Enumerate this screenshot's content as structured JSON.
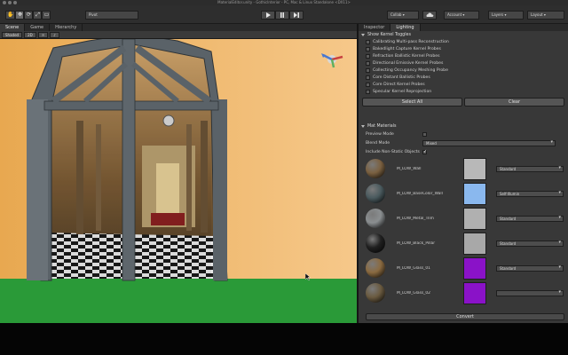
{
  "window": {
    "title": "MaterialEditor.unity - GothicInterior - PC, Mac & Linux Standalone <DX11>"
  },
  "toolbar": {
    "transform_tools": [
      "✋",
      "✥",
      "⟳",
      "⤢",
      "▭"
    ],
    "pivot_label": "Pivot",
    "play_icon": "play-icon",
    "pause_icon": "pause-icon",
    "step_icon": "step-icon",
    "collab_label": "Collab ▾",
    "account_label": "Account ▾",
    "layers_label": "Layers ▾",
    "layout_label": "Layout ▾"
  },
  "scene": {
    "tabs": [
      "Scene",
      "Game",
      "Hierarchy"
    ],
    "controls": [
      "Shaded",
      "2D",
      "☼",
      "♪"
    ]
  },
  "inspector": {
    "tabs": [
      "Inspector",
      "Lighting"
    ],
    "toggles_title": "Show Kernel Toggles",
    "toggles": [
      "Calibrating Multi-pass Reconstruction",
      "Bakedlight Capture Kernel Probes",
      "Refraction Ballistic Kernel Probes",
      "Directional Emissive Kernel Probes",
      "Collecting Occupancy Meshing Probe",
      "Core Distant Ballistic Probes",
      "Core Direct Kernel Probes",
      "Specular Kernel Reprojection"
    ],
    "select_all": "Select All",
    "clear": "Clear",
    "materials_title": "Mat Materials",
    "preview_mode_label": "Preview Mode",
    "preview_mode_value": "",
    "blend_label": "Blend Mode",
    "blend_value": "Mixed",
    "static_label": "Include Non-Static Objects",
    "materials": [
      {
        "name": "M_LOW_Wall",
        "sphere": "#7a6040",
        "swatch": "#b8b8b8",
        "shader": "Standard"
      },
      {
        "name": "M_LOW_BaseColor_Wall",
        "sphere": "#4a5a5e",
        "swatch": "#8ab8ee",
        "shader": "Self-Illumin"
      },
      {
        "name": "M_LOW_Metal_Trim",
        "sphere": "#8a8e90",
        "swatch": "#b0b0b0",
        "shader": "Standard"
      },
      {
        "name": "M_LOW_Black_Pillar",
        "sphere": "#202020",
        "swatch": "#a8a8a8",
        "shader": "Standard"
      },
      {
        "name": "M_LOW_Glass_01",
        "sphere": "#8a6a40",
        "swatch": "#8a12c8",
        "shader": "Standard"
      },
      {
        "name": "M_LOW_Glass_02",
        "sphere": "#6a5a40",
        "swatch": "#8a12c8",
        "shader": ""
      }
    ],
    "footer_button": "Convert"
  },
  "colors": {
    "wall": "#f0b86a",
    "frame": "#5a6268",
    "floor": "#2a9a38",
    "panel": "#383838"
  }
}
